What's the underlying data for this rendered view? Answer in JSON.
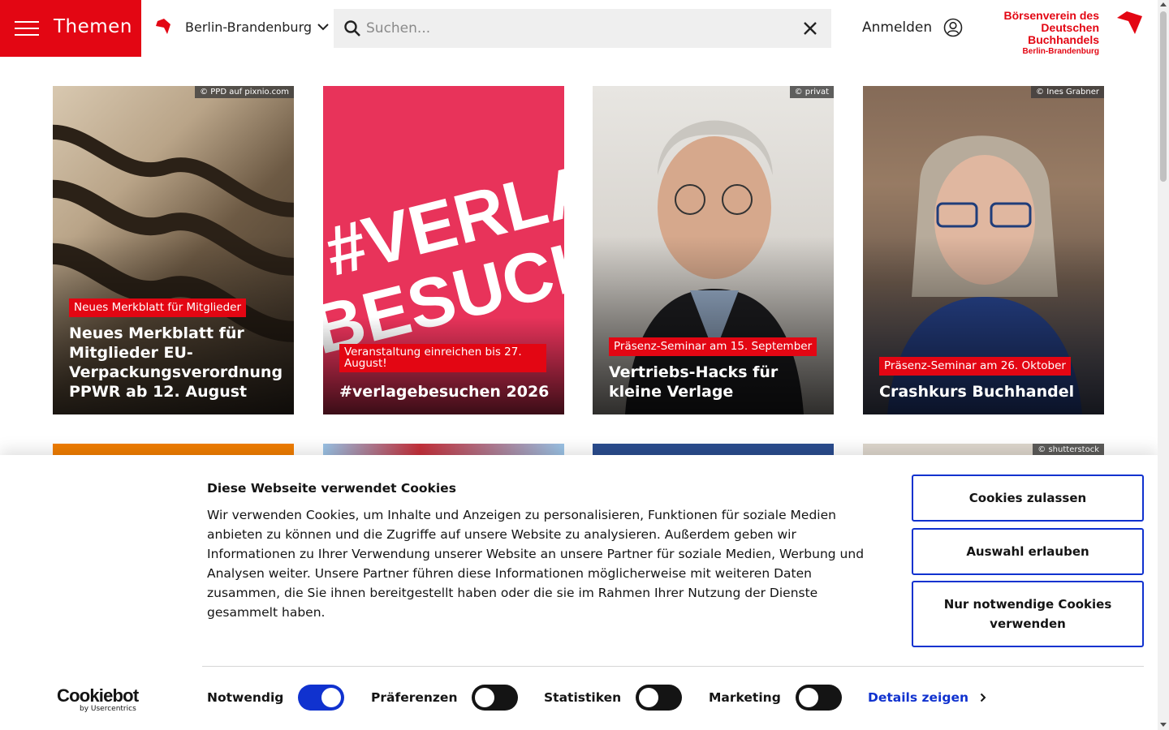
{
  "header": {
    "menu_label": "Themen",
    "region_label": "Berlin-Brandenburg",
    "search_placeholder": "Suchen...",
    "login_label": "Anmelden",
    "logo": {
      "line1": "Börsenverein des",
      "line2": "Deutschen Buchhandels",
      "line3": "Berlin-Brandenburg"
    },
    "brand_color": "#e30613"
  },
  "cards": [
    {
      "credit": "© PPD auf pixnio.com",
      "tag": "Neues Merkblatt für Mitglieder",
      "title": "Neues Merkblatt für Mitglieder EU-Verpackungsverordnung PPWR ab 12. August"
    },
    {
      "credit": "",
      "image_text_1": "#VERLAGE",
      "image_text_2": "BESUCHEN",
      "tag": "Veranstaltung einreichen bis 27. August!",
      "title": "#verlagebesuchen 2026"
    },
    {
      "credit": "© privat",
      "tag": "Präsenz-Seminar am 15. September",
      "title": "Vertriebs-Hacks für kleine Verlage"
    },
    {
      "credit": "© Ines Grabner",
      "tag": "Präsenz-Seminar am 26. Oktober",
      "title": "Crashkurs Buchhandel"
    }
  ],
  "row2_credit": "© shutterstock",
  "cookie": {
    "title": "Diese Webseite verwendet Cookies",
    "text": "Wir verwenden Cookies, um Inhalte und Anzeigen zu personalisieren, Funktionen für soziale Medien anbieten zu können und die Zugriffe auf unsere Website zu analysieren. Außerdem geben wir Informationen zu Ihrer Verwendung unserer Website an unsere Partner für soziale Medien, Werbung und Analysen weiter. Unsere Partner führen diese Informationen möglicherweise mit weiteren Daten zusammen, die Sie ihnen bereitgestellt haben oder die sie im Rahmen Ihrer Nutzung der Dienste gesammelt haben.",
    "btn_allow_all": "Cookies zulassen",
    "btn_allow_selection": "Auswahl erlauben",
    "btn_necessary": "Nur notwendige Cookies verwenden",
    "logo_main": "Cookiebot",
    "logo_sub": "by Usercentrics",
    "options": [
      {
        "label": "Notwendig",
        "on": true
      },
      {
        "label": "Präferenzen",
        "on": false
      },
      {
        "label": "Statistiken",
        "on": false
      },
      {
        "label": "Marketing",
        "on": false
      }
    ],
    "details_label": "Details zeigen",
    "accent_color": "#1032cf"
  }
}
